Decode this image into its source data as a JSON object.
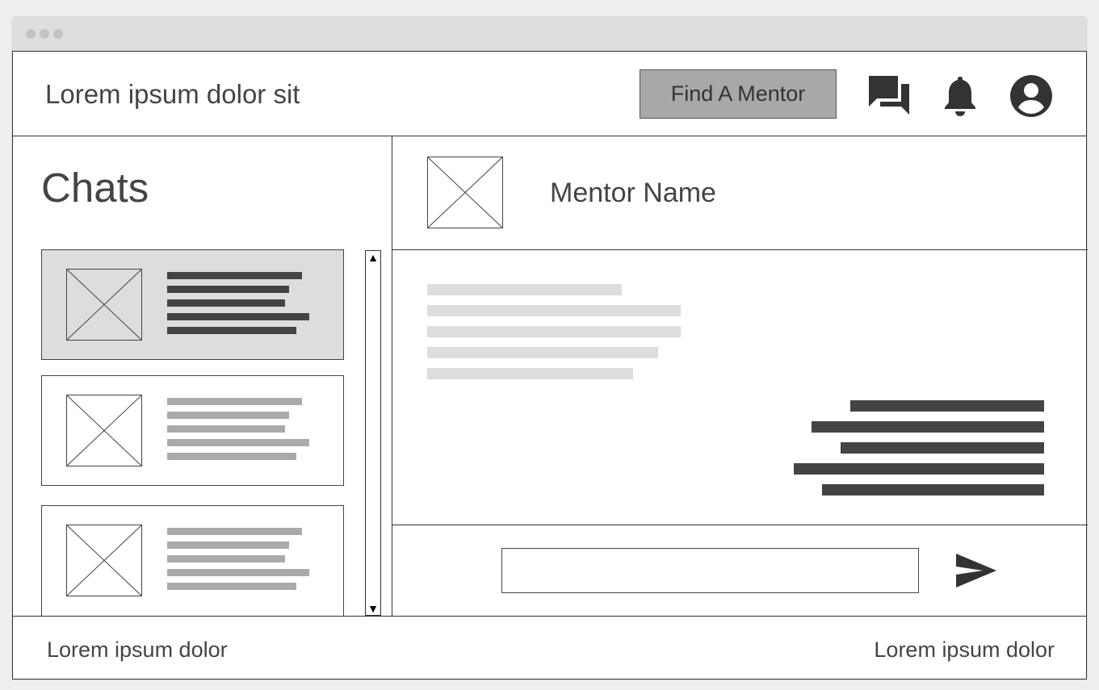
{
  "header": {
    "title": "Lorem ipsum dolor sit",
    "find_mentor_label": "Find A Mentor",
    "icons": [
      "chat-bubbles-icon",
      "bell-icon",
      "account-circle-icon"
    ]
  },
  "sidebar": {
    "title": "Chats",
    "items": [
      {
        "state": "active",
        "icon": "image-placeholder-icon"
      },
      {
        "state": "default",
        "icon": "image-placeholder-icon"
      },
      {
        "state": "default",
        "icon": "image-placeholder-icon"
      }
    ],
    "scroll_up": "▲",
    "scroll_down": "▼"
  },
  "chat": {
    "mentor_name": "Mentor Name",
    "input_value": "",
    "send_icon": "send-icon"
  },
  "footer": {
    "left_text": "Lorem ipsum dolor",
    "right_text": "Lorem ipsum dolor"
  },
  "colors": {
    "button_bg": "#a8a8a8",
    "active_item_bg": "#dddddd",
    "dark_text_bar": "#444444",
    "light_text_bar": "#aaaaaa",
    "incoming_bar": "#dddddd",
    "icon": "#333333"
  }
}
